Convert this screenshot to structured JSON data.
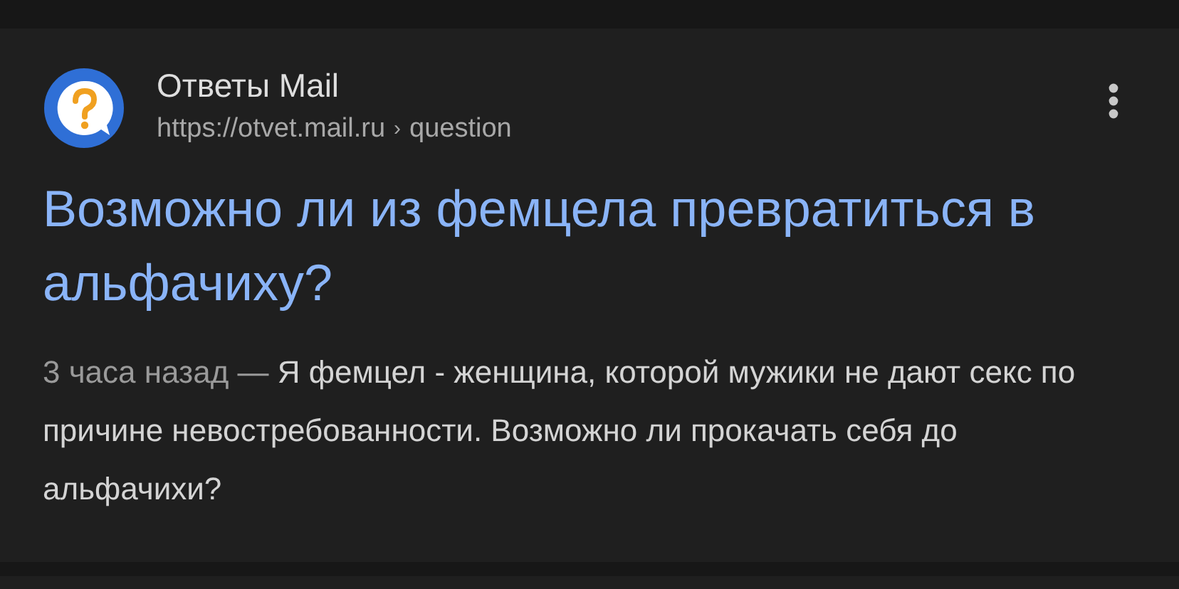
{
  "result": {
    "site_name": "Ответы Mail",
    "url": "https://otvet.mail.ru",
    "breadcrumb_separator": "›",
    "breadcrumb": "question",
    "title": "Возможно ли из фемцела превратиться в альфачиху?",
    "date": "3 часа назад",
    "date_separator": "—",
    "snippet": "Я фемцел - женщина, которой мужики не дают секс по причине невостребованности. Возможно ли прокачать себя до альфачихи?"
  }
}
